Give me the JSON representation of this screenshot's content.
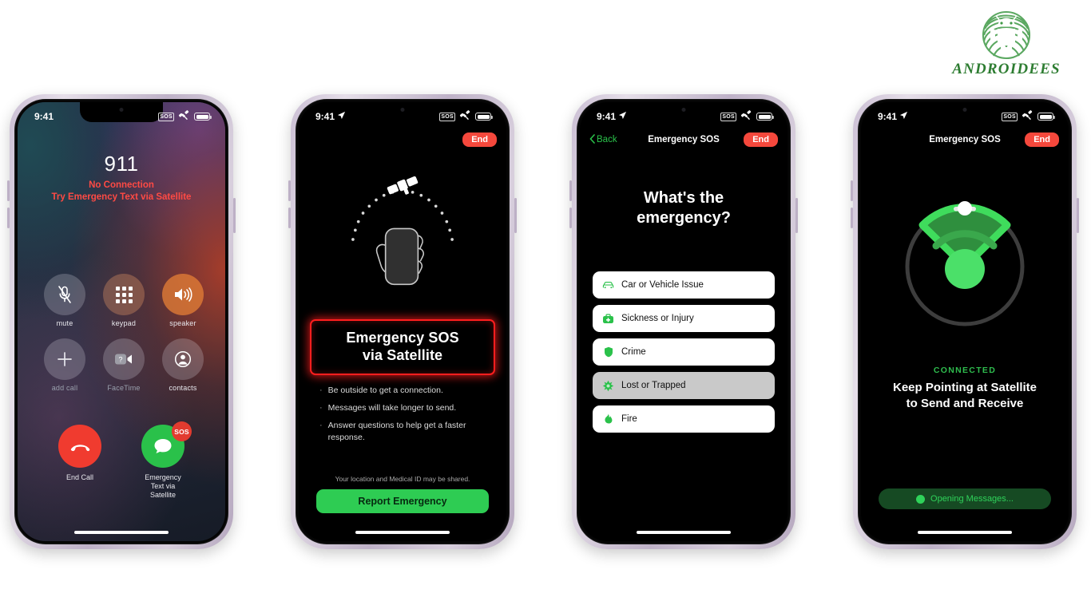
{
  "brand": {
    "name": "ANDROIDEES",
    "logo_icon": "android-robot-icon",
    "color": "#2e7d32"
  },
  "phones": [
    {
      "id": "call-screen",
      "status_bar": {
        "time": "9:41",
        "sos_label": "SOS",
        "satellite_icon": "satellite-icon",
        "battery_icon": "battery-full-icon"
      },
      "call": {
        "number": "911",
        "status_line1": "No Connection",
        "status_line2": "Try Emergency Text via Satellite",
        "status_color": "#ff4a44",
        "controls": [
          {
            "icon": "mic-muted-icon",
            "label": "mute",
            "state": "normal"
          },
          {
            "icon": "keypad-icon",
            "label": "keypad",
            "state": "normal"
          },
          {
            "icon": "speaker-icon",
            "label": "speaker",
            "state": "active"
          },
          {
            "icon": "plus-icon",
            "label": "add call",
            "state": "disabled"
          },
          {
            "icon": "facetime-video-icon",
            "label": "FaceTime",
            "state": "disabled"
          },
          {
            "icon": "contacts-icon",
            "label": "contacts",
            "state": "normal"
          }
        ],
        "end_call": {
          "icon": "end-call-icon",
          "label": "End Call",
          "color": "#f03b2f"
        },
        "emergency_text": {
          "icon": "message-bubble-icon",
          "badge": "SOS",
          "label": "Emergency\nText via\nSatellite",
          "color": "#2ac14a"
        }
      }
    },
    {
      "id": "sos-via-satellite-intro",
      "status_bar": {
        "time": "9:41",
        "location_icon": "location-arrow-icon",
        "sos_label": "SOS",
        "satellite_icon": "satellite-icon",
        "battery_icon": "battery-full-icon"
      },
      "end_button": "End",
      "illustration_icon": "hand-holding-phone-pointing-at-satellite-icon",
      "title_line1": "Emergency SOS",
      "title_line2": "via Satellite",
      "title_border_color": "#ff1e1e",
      "bullets": [
        "Be outside to get a connection.",
        "Messages will take longer to send.",
        "Answer questions to help get a faster response."
      ],
      "share_note": "Your location and Medical ID may be shared.",
      "cta_label": "Report Emergency",
      "cta_color": "#2ecc53"
    },
    {
      "id": "emergency-question",
      "status_bar": {
        "time": "9:41",
        "location_icon": "location-arrow-icon",
        "sos_label": "SOS",
        "satellite_icon": "satellite-icon",
        "battery_icon": "battery-full-icon"
      },
      "back_label": "Back",
      "nav_title": "Emergency SOS",
      "end_button": "End",
      "question_line1": "What's the",
      "question_line2": "emergency?",
      "options": [
        {
          "icon": "car-icon",
          "label": "Car or Vehicle Issue",
          "selected": false
        },
        {
          "icon": "medical-bag-icon",
          "label": "Sickness or Injury",
          "selected": false
        },
        {
          "icon": "shield-icon",
          "label": "Crime",
          "selected": false
        },
        {
          "icon": "compass-icon",
          "label": "Lost or Trapped",
          "selected": true
        },
        {
          "icon": "flame-icon",
          "label": "Fire",
          "selected": false
        }
      ]
    },
    {
      "id": "satellite-connected",
      "status_bar": {
        "time": "9:41",
        "location_icon": "location-arrow-icon",
        "sos_label": "SOS",
        "satellite_icon": "satellite-icon",
        "battery_icon": "battery-full-icon"
      },
      "nav_title": "Emergency SOS",
      "end_button": "End",
      "radar_icon": "satellite-pointing-radar-icon",
      "connection_state": "CONNECTED",
      "connection_color": "#2fbd4e",
      "instruction_line1": "Keep Pointing at Satellite",
      "instruction_line2": "to Send and Receive",
      "opening_pill": {
        "icon": "message-bubble-icon",
        "label": "Opening Messages..."
      }
    }
  ]
}
